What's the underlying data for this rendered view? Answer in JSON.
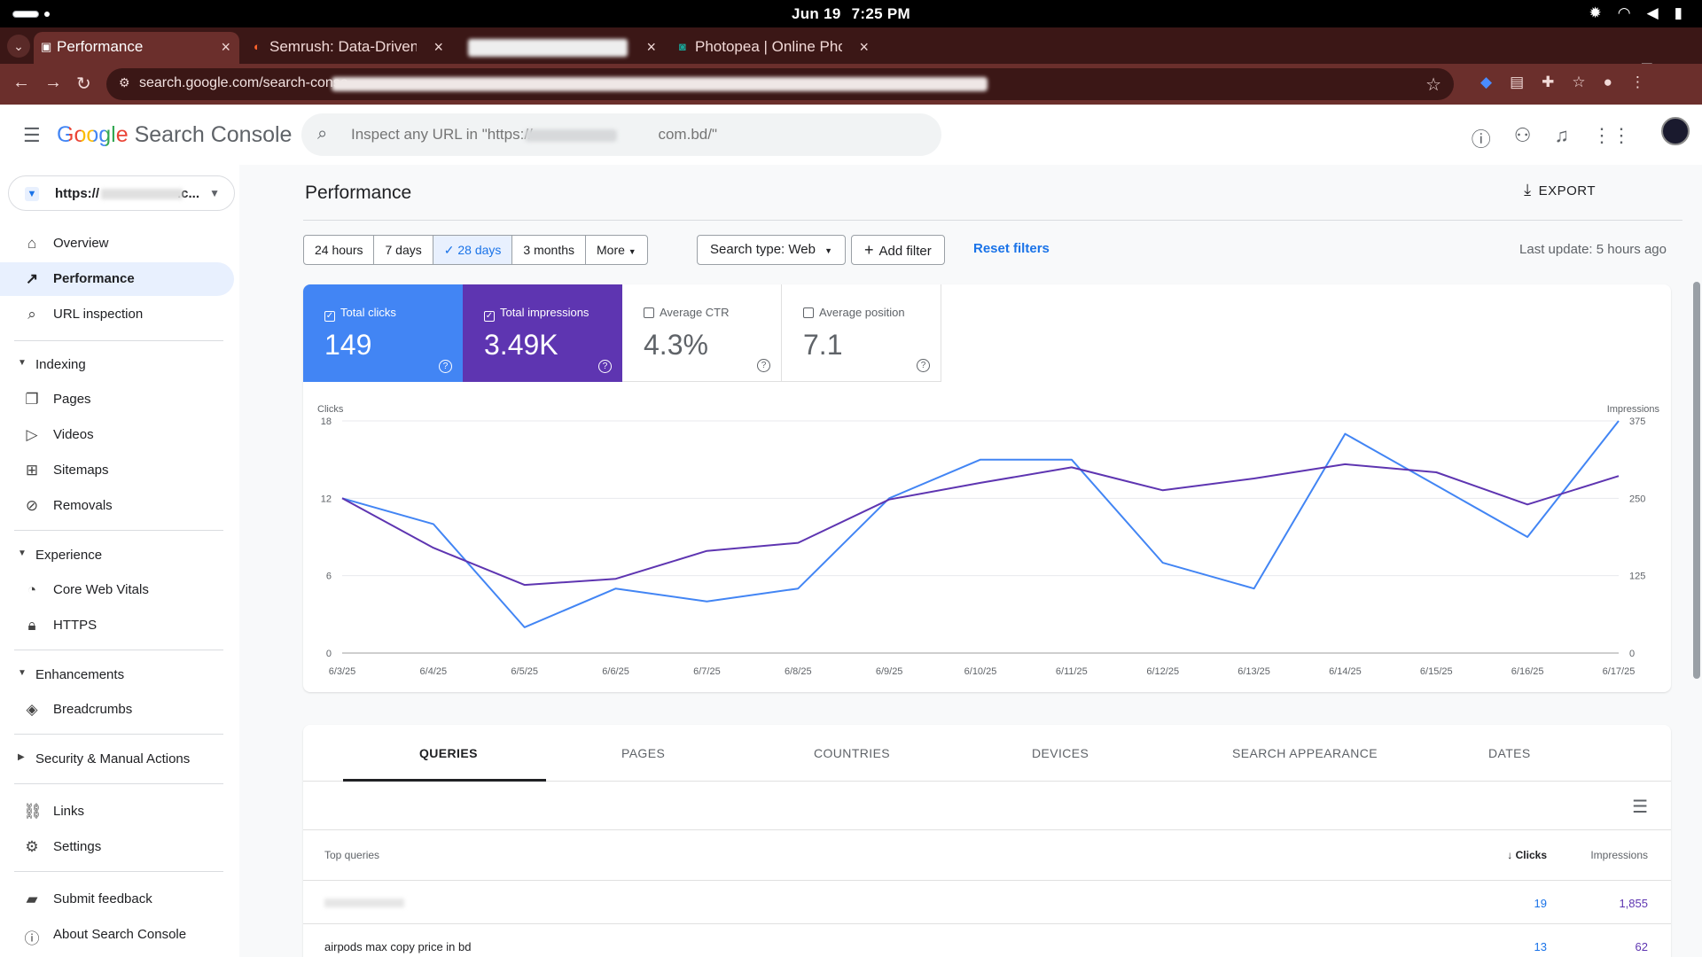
{
  "os": {
    "date": "Jun 19",
    "time": "7:25 PM"
  },
  "browser": {
    "tabs": [
      {
        "title": "Performance",
        "active": true
      },
      {
        "title": "Semrush: Data-Driven M",
        "active": false
      },
      {
        "title": "",
        "active": false
      },
      {
        "title": "Photopea | Online Phot",
        "active": false
      }
    ],
    "url_prefix": "search.google.com/search-conso"
  },
  "header": {
    "logo_google": "Google",
    "logo_product": " Search Console",
    "search_placeholder": "Inspect any URL in \"https://                              com.bd/\""
  },
  "sidebar": {
    "property": "https://",
    "property_suffix": ".c...",
    "items": [
      {
        "label": "Overview",
        "icon": "home-icon"
      },
      {
        "label": "Performance",
        "icon": "trending-icon",
        "active": true
      },
      {
        "label": "URL inspection",
        "icon": "search-icon"
      }
    ],
    "sections": {
      "indexing": {
        "title": "Indexing",
        "items": [
          "Pages",
          "Videos",
          "Sitemaps",
          "Removals"
        ]
      },
      "experience": {
        "title": "Experience",
        "items": [
          "Core Web Vitals",
          "HTTPS"
        ]
      },
      "enhancements": {
        "title": "Enhancements",
        "items": [
          "Breadcrumbs"
        ]
      },
      "security": {
        "title": "Security & Manual Actions"
      }
    },
    "bottom": [
      "Links",
      "Settings",
      "Submit feedback",
      "About Search Console"
    ]
  },
  "main": {
    "title": "Performance",
    "export_label": "EXPORT",
    "date_ranges": [
      "24 hours",
      "7 days",
      "28 days",
      "3 months",
      "More"
    ],
    "selected_range": "28 days",
    "search_type": "Search type: Web",
    "add_filter": "Add filter",
    "reset_filters": "Reset filters",
    "last_update": "Last update: 5 hours ago",
    "metrics": [
      {
        "label": "Total clicks",
        "value": "149",
        "checked": true
      },
      {
        "label": "Total impressions",
        "value": "3.49K",
        "checked": true
      },
      {
        "label": "Average CTR",
        "value": "4.3%",
        "checked": false
      },
      {
        "label": "Average position",
        "value": "7.1",
        "checked": false
      }
    ],
    "tabs": [
      "QUERIES",
      "PAGES",
      "COUNTRIES",
      "DEVICES",
      "SEARCH APPEARANCE",
      "DATES"
    ],
    "table": {
      "title": "Top queries",
      "col_clicks": "Clicks",
      "col_impressions": "Impressions",
      "rows": [
        {
          "query": "",
          "clicks": "19",
          "impressions": "1,855"
        },
        {
          "query": "airpods max copy price in bd",
          "clicks": "13",
          "impressions": "62"
        }
      ]
    }
  },
  "colors": {
    "clicks": "#4285f4",
    "impressions": "#5e35b1",
    "accent": "#1a73e8"
  },
  "chart_data": {
    "type": "line",
    "x": [
      "6/3/25",
      "6/4/25",
      "6/5/25",
      "6/6/25",
      "6/7/25",
      "6/8/25",
      "6/9/25",
      "6/10/25",
      "6/11/25",
      "6/12/25",
      "6/13/25",
      "6/14/25",
      "6/15/25",
      "6/16/25",
      "6/17/25"
    ],
    "series": [
      {
        "name": "Clicks",
        "axis": "left",
        "color": "#4285f4",
        "values": [
          12,
          10,
          2,
          5,
          4,
          5,
          12,
          15,
          15,
          7,
          5,
          17,
          13,
          9,
          18
        ]
      },
      {
        "name": "Impressions",
        "axis": "right",
        "color": "#5e35b1",
        "values": [
          250,
          170,
          110,
          120,
          165,
          178,
          248,
          275,
          300,
          263,
          282,
          305,
          292,
          240,
          286
        ]
      }
    ],
    "ylabel_left": "Clicks",
    "ylabel_right": "Impressions",
    "yticks_left": [
      "0",
      "6",
      "12",
      "18"
    ],
    "yticks_right": [
      "0",
      "125",
      "250",
      "375"
    ],
    "ylim_left": [
      0,
      18
    ],
    "ylim_right": [
      0,
      375
    ],
    "grid": true
  }
}
